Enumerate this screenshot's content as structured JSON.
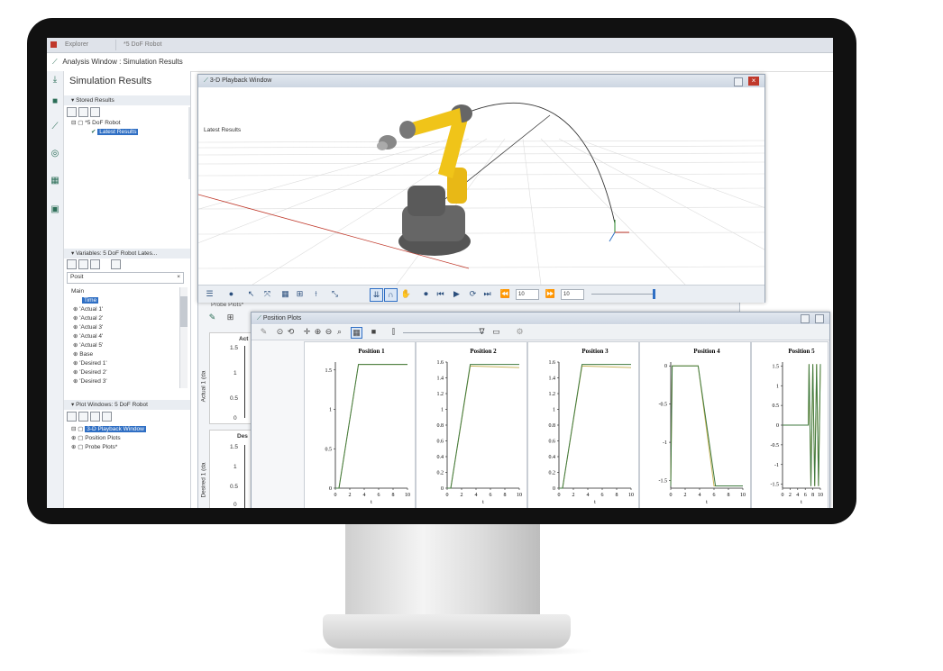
{
  "titlebar": {
    "tabs": [
      "Explorer",
      "*5 DoF Robot"
    ]
  },
  "analysis_title": "Analysis Window : Simulation Results",
  "panel": {
    "title": "Simulation Results",
    "stored_results": {
      "header": "Stored Results",
      "robot": "*5 DoF Robot",
      "selected": "Latest Results"
    },
    "variables": {
      "header": "Variables: 5 DoF Robot Lates...",
      "search_value": "Posit",
      "search_clear": "×",
      "tree_root": "Main",
      "selected": "Time",
      "items": [
        "'Actual 1'",
        "'Actual 2'",
        "'Actual 3'",
        "'Actual 4'",
        "'Actual 5'",
        "Base",
        "'Desired 1'",
        "'Desired 2'",
        "'Desired 3'"
      ]
    },
    "plot_windows": {
      "header": "Plot Windows: 5 DoF Robot",
      "items": [
        "3-D Playback Window",
        "Position Plots",
        "Probe Plots*"
      ]
    }
  },
  "playback": {
    "title": "3-D Playback Window",
    "scene_label": "Latest Results",
    "frame_value": "10",
    "end_value": "10",
    "close": "×"
  },
  "probe": {
    "title": "Probe Plots*",
    "plot_title_1": "Act",
    "plot_title_2": "Des",
    "ylabel_1": "Actual 1 (da",
    "ylabel_2": "Desired 1 (da",
    "ticks_1": [
      "1.5",
      "1",
      "0.5",
      "0"
    ],
    "ticks_2": [
      "1.5",
      "1",
      "0.5",
      "0"
    ]
  },
  "posplots": {
    "title": "Position Plots"
  },
  "colors": {
    "accent": "#2f6fc4",
    "robot_yellow": "#f0c419",
    "curve_green": "#3f7a3f",
    "curve_tan": "#c8b45a"
  },
  "chart_data": [
    {
      "type": "line",
      "title": "Position 1",
      "xlabel": "t",
      "ylabel": "",
      "xlim": [
        0,
        10
      ],
      "ylim": [
        0,
        1.6
      ],
      "x_ticks": [
        0,
        2,
        4,
        6,
        8,
        10
      ],
      "y_ticks": [
        0,
        0.5,
        1,
        1.5
      ],
      "series": [
        {
          "x": [
            0,
            0.5,
            3.2,
            10
          ],
          "y": [
            0,
            0,
            1.57,
            1.57
          ]
        },
        {
          "x": [
            0,
            0.5,
            3.2,
            10
          ],
          "y": [
            0,
            0,
            1.57,
            1.57
          ]
        }
      ]
    },
    {
      "type": "line",
      "title": "Position 2",
      "xlabel": "t",
      "ylabel": "",
      "xlim": [
        0,
        10
      ],
      "ylim": [
        0,
        1.6
      ],
      "x_ticks": [
        0,
        2,
        4,
        6,
        8,
        10
      ],
      "y_ticks": [
        0,
        0.2,
        0.4,
        0.6,
        0.8,
        1,
        1.2,
        1.4,
        1.6
      ],
      "series": [
        {
          "x": [
            0,
            0.5,
            3.2,
            10
          ],
          "y": [
            0,
            0,
            1.55,
            1.53
          ]
        },
        {
          "x": [
            0,
            0.5,
            3.2,
            10
          ],
          "y": [
            0,
            0,
            1.57,
            1.57
          ]
        }
      ]
    },
    {
      "type": "line",
      "title": "Position 3",
      "xlabel": "t",
      "ylabel": "",
      "xlim": [
        0,
        10
      ],
      "ylim": [
        0,
        1.6
      ],
      "x_ticks": [
        0,
        2,
        4,
        6,
        8,
        10
      ],
      "y_ticks": [
        0,
        0.2,
        0.4,
        0.6,
        0.8,
        1,
        1.2,
        1.4,
        1.6
      ],
      "series": [
        {
          "x": [
            0,
            0.5,
            3.2,
            10
          ],
          "y": [
            0,
            0,
            1.55,
            1.53
          ]
        },
        {
          "x": [
            0,
            0.5,
            3.2,
            10
          ],
          "y": [
            0,
            0,
            1.57,
            1.57
          ]
        }
      ]
    },
    {
      "type": "line",
      "title": "Position 4",
      "xlabel": "t",
      "ylabel": "",
      "xlim": [
        0,
        10
      ],
      "ylim": [
        -1.6,
        0.05
      ],
      "x_ticks": [
        0,
        2,
        4,
        6,
        8,
        10
      ],
      "y_ticks": [
        0,
        -0.5,
        -1,
        -1.5
      ],
      "series": [
        {
          "x": [
            0,
            0.2,
            3,
            3.8,
            6,
            10
          ],
          "y": [
            -1.57,
            0,
            0,
            0,
            -1.57,
            -1.57
          ]
        },
        {
          "x": [
            0,
            0.2,
            3,
            3.8,
            6.2,
            10
          ],
          "y": [
            -1.57,
            0,
            0,
            0,
            -1.57,
            -1.57
          ]
        }
      ]
    },
    {
      "type": "line",
      "title": "Position 5",
      "xlabel": "t",
      "ylabel": "",
      "xlim": [
        0,
        10
      ],
      "ylim": [
        -1.6,
        1.6
      ],
      "x_ticks": [
        0,
        2,
        4,
        6,
        8,
        10
      ],
      "y_ticks": [
        -1.5,
        -1,
        -0.5,
        0,
        0.5,
        1,
        1.5
      ],
      "series": [
        {
          "x": [
            0,
            6.8,
            7.0,
            7.5,
            8.0,
            8.5,
            9.0,
            9.5,
            10
          ],
          "y": [
            0,
            0,
            1.55,
            -1.55,
            1.55,
            -1.55,
            1.55,
            -1.55,
            1.55
          ]
        },
        {
          "x": [
            0,
            6.8,
            7.0,
            7.5,
            8.0,
            8.5,
            9.0,
            9.5,
            10
          ],
          "y": [
            0,
            0,
            1.55,
            -1.55,
            1.55,
            -1.55,
            1.55,
            -1.55,
            1.55
          ]
        }
      ]
    }
  ]
}
